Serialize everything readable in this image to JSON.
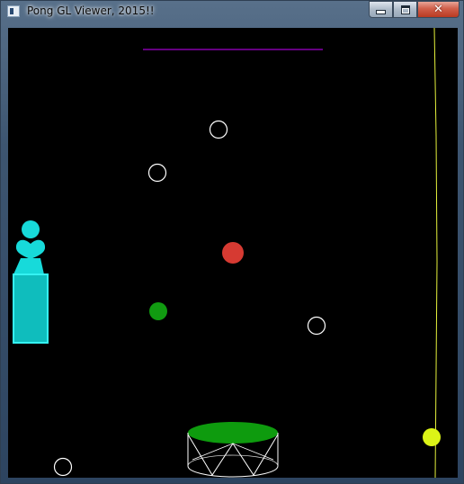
{
  "window": {
    "title": "Pong GL Viewer, 2015!!",
    "icon": "window-app-icon",
    "controls": {
      "minimize_icon": "minimize-icon",
      "maximize_icon": "maximize-icon",
      "close_glyph": "✕",
      "close_icon": "close-icon"
    }
  },
  "scene": {
    "background_color": "#000000",
    "colors": {
      "top_paddle": "#c800ff",
      "right_paddle": "#e6f23c",
      "ball": "#d63a32",
      "green_ball": "#119b11",
      "outline_balls": "#ffffff",
      "player_figure": "#17dada",
      "goal_cylinder_top": "#0e9b0e",
      "goal_cylinder_wire": "#ffffff",
      "yellow_ball": "#dcf417"
    }
  }
}
